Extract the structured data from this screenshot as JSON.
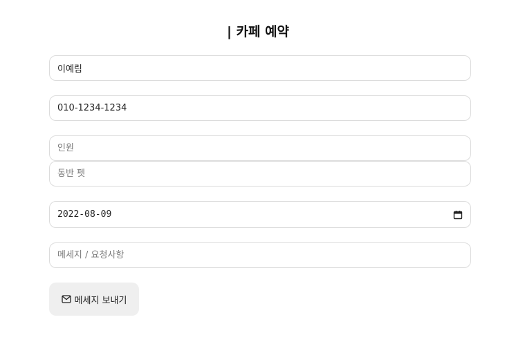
{
  "form": {
    "title": "| 카페 예약",
    "name_value": "이예림",
    "phone_value": "010-1234-1234",
    "guests_placeholder": "인원",
    "pet_placeholder": "동반 펫",
    "date_value": "2022-08-09",
    "message_placeholder": "메세지 / 요청사항",
    "send_label": "메세지 보내기"
  },
  "icons": {
    "date_picker": "calendar-icon",
    "send": "envelope-icon"
  }
}
